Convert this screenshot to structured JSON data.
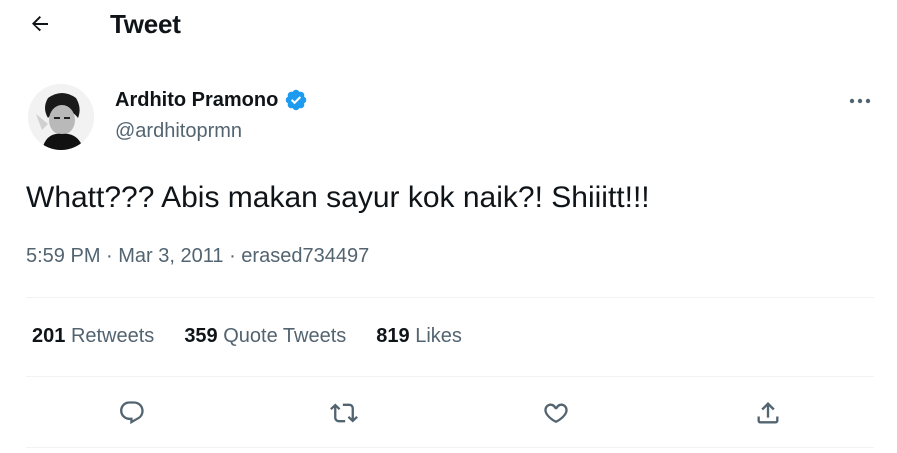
{
  "header": {
    "title": "Tweet",
    "back_icon": "back-arrow-icon"
  },
  "tweet": {
    "author": {
      "name": "Ardhito Pramono",
      "handle": "@ardhitoprmn",
      "verified_icon": "verified-badge-icon"
    },
    "text": "Whatt??? Abis makan sayur kok naik?! Shiiitt!!!",
    "meta": {
      "time": "5:59 PM",
      "separator1": " · ",
      "date": "Mar 3, 2011",
      "separator2": " · ",
      "source": "erased734497"
    },
    "stats": {
      "retweets": {
        "count": "201",
        "label": "Retweets"
      },
      "quote_tweets": {
        "count": "359",
        "label": "Quote Tweets"
      },
      "likes": {
        "count": "819",
        "label": "Likes"
      }
    }
  },
  "actions": [
    "reply-icon",
    "retweet-icon",
    "like-icon",
    "share-icon"
  ],
  "colors": {
    "text_primary": "#0f1419",
    "text_secondary": "#536471",
    "divider": "#eff3f4",
    "verified": "#1d9bf0"
  }
}
